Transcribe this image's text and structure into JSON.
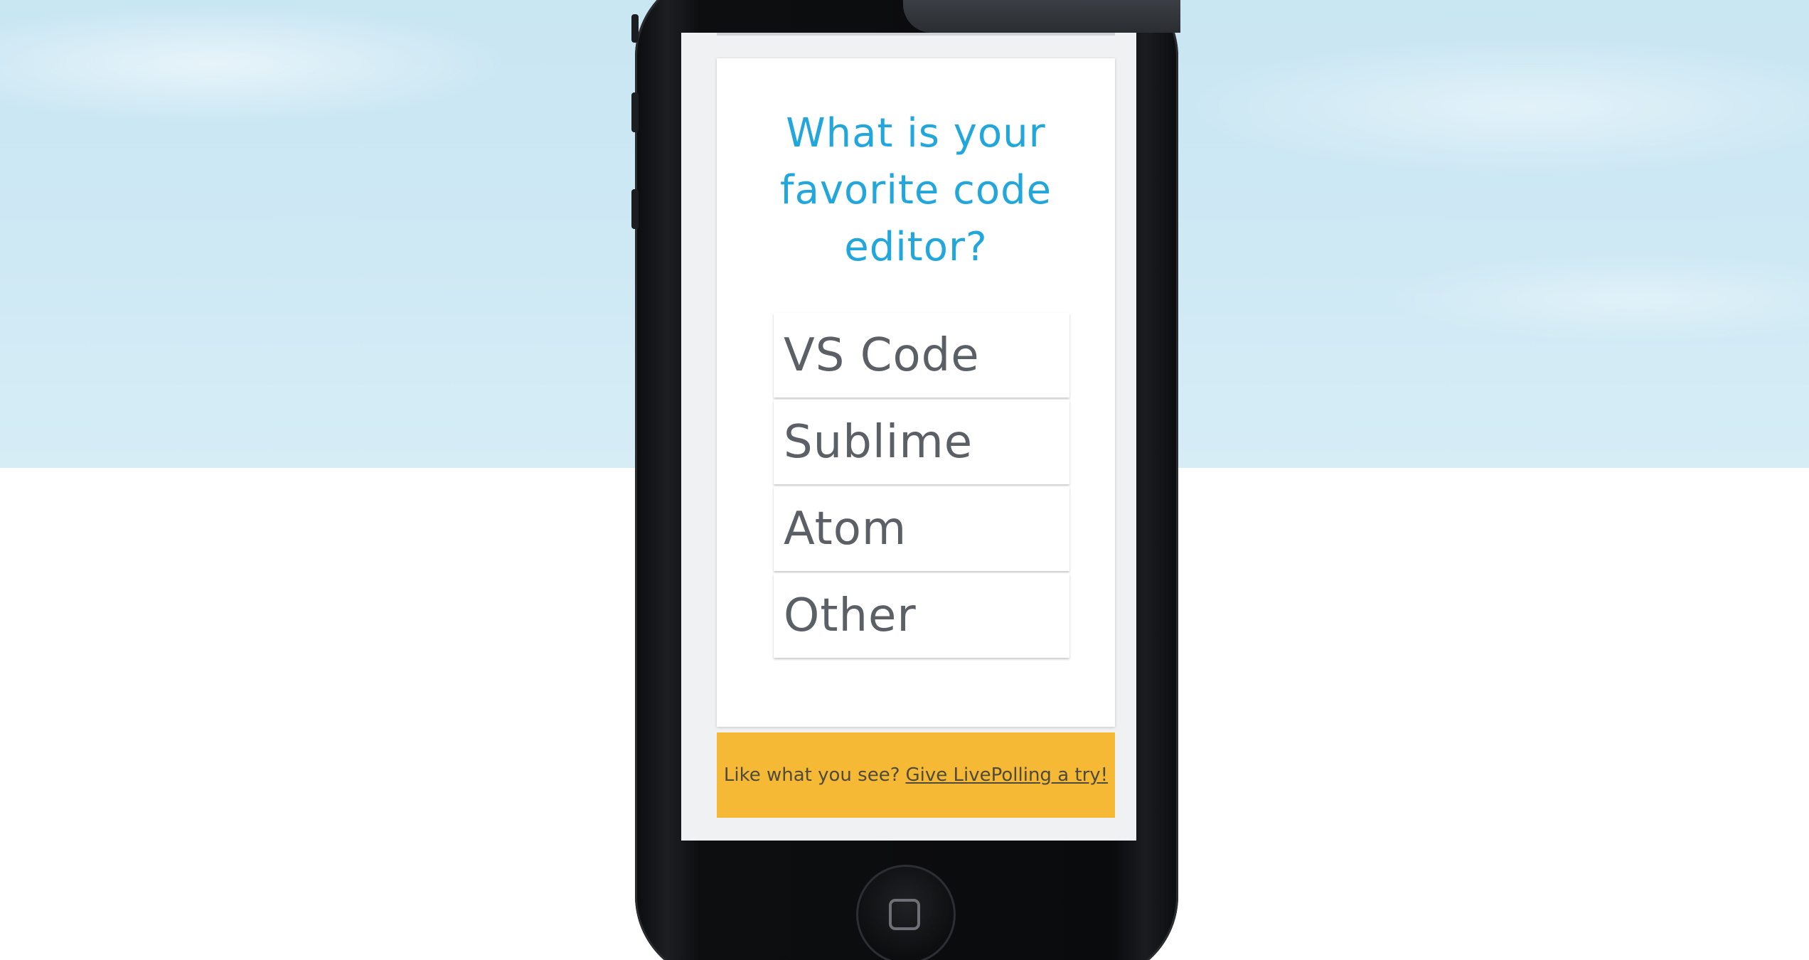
{
  "poll": {
    "question": "What is your favorite code editor?",
    "options": [
      {
        "label": "VS Code"
      },
      {
        "label": "Sublime"
      },
      {
        "label": "Atom"
      },
      {
        "label": "Other"
      }
    ]
  },
  "banner": {
    "text": "Like what you see?",
    "link_text": "Give LivePolling a try!"
  },
  "colors": {
    "question": "#21a7db",
    "banner_bg": "#f6b935",
    "option_text": "#5b5f66"
  },
  "icons": {
    "home_button": "home-button-icon"
  }
}
